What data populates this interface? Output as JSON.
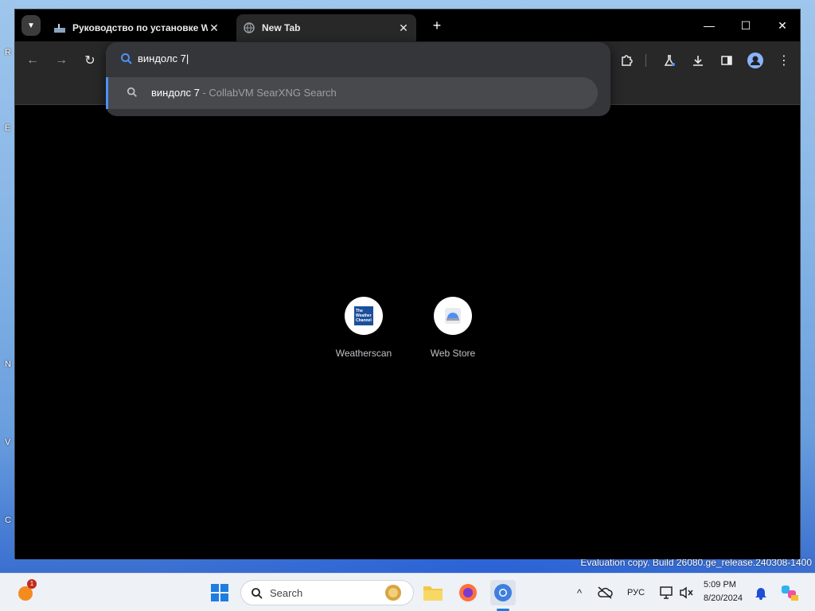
{
  "tabs": [
    {
      "title": "Руководство по установке Wi",
      "close": "✕"
    },
    {
      "title": "New Tab",
      "close": "✕"
    }
  ],
  "tab_menu_icon": "chevron-down-icon",
  "new_tab_label": "+",
  "window_controls": {
    "minimize": "—",
    "maximize": "☐",
    "close": "✕"
  },
  "omnibox": {
    "input_value": "виндолс 7",
    "suggestion": {
      "query": "виндолс 7",
      "separator": " - ",
      "engine": "CollabVM SearXNG Search"
    }
  },
  "shortcuts": [
    {
      "label": "Weatherscan",
      "logo_text": "The Weather Channel"
    },
    {
      "label": "Web Store"
    }
  ],
  "watermark": "Evaluation copy. Build 26080.ge_release.240308-1400",
  "taskbar": {
    "search_label": "Search",
    "notification_count": "1",
    "language": "РУС",
    "time": "5:09 PM",
    "date": "8/20/2024"
  },
  "colors": {
    "accent": "#4f8ff7",
    "window_bg": "#000000",
    "toolbar_bg": "#282828"
  }
}
